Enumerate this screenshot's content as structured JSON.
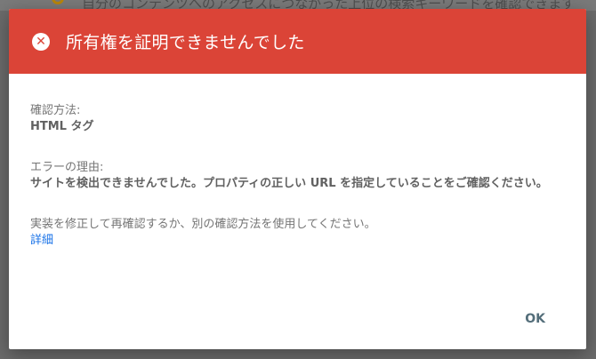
{
  "background": {
    "partial_text": "自分のコンテンツへのアクセスにつながった上位の検索キーワードを確認できます",
    "icon": "search-icon"
  },
  "dialog": {
    "header_color": "#db4437",
    "icon": "error-circle-icon",
    "title": "所有権を証明できませんでした",
    "method_label": "確認方法:",
    "method_value": "HTML タグ",
    "reason_label": "エラーの理由:",
    "reason_value": "サイトを検出できませんでした。プロパティの正しい URL を指定していることをご確認ください。",
    "hint": "実装を修正して再確認するか、別の確認方法を使用してください。",
    "details_link": "詳細",
    "ok_label": "OK"
  }
}
